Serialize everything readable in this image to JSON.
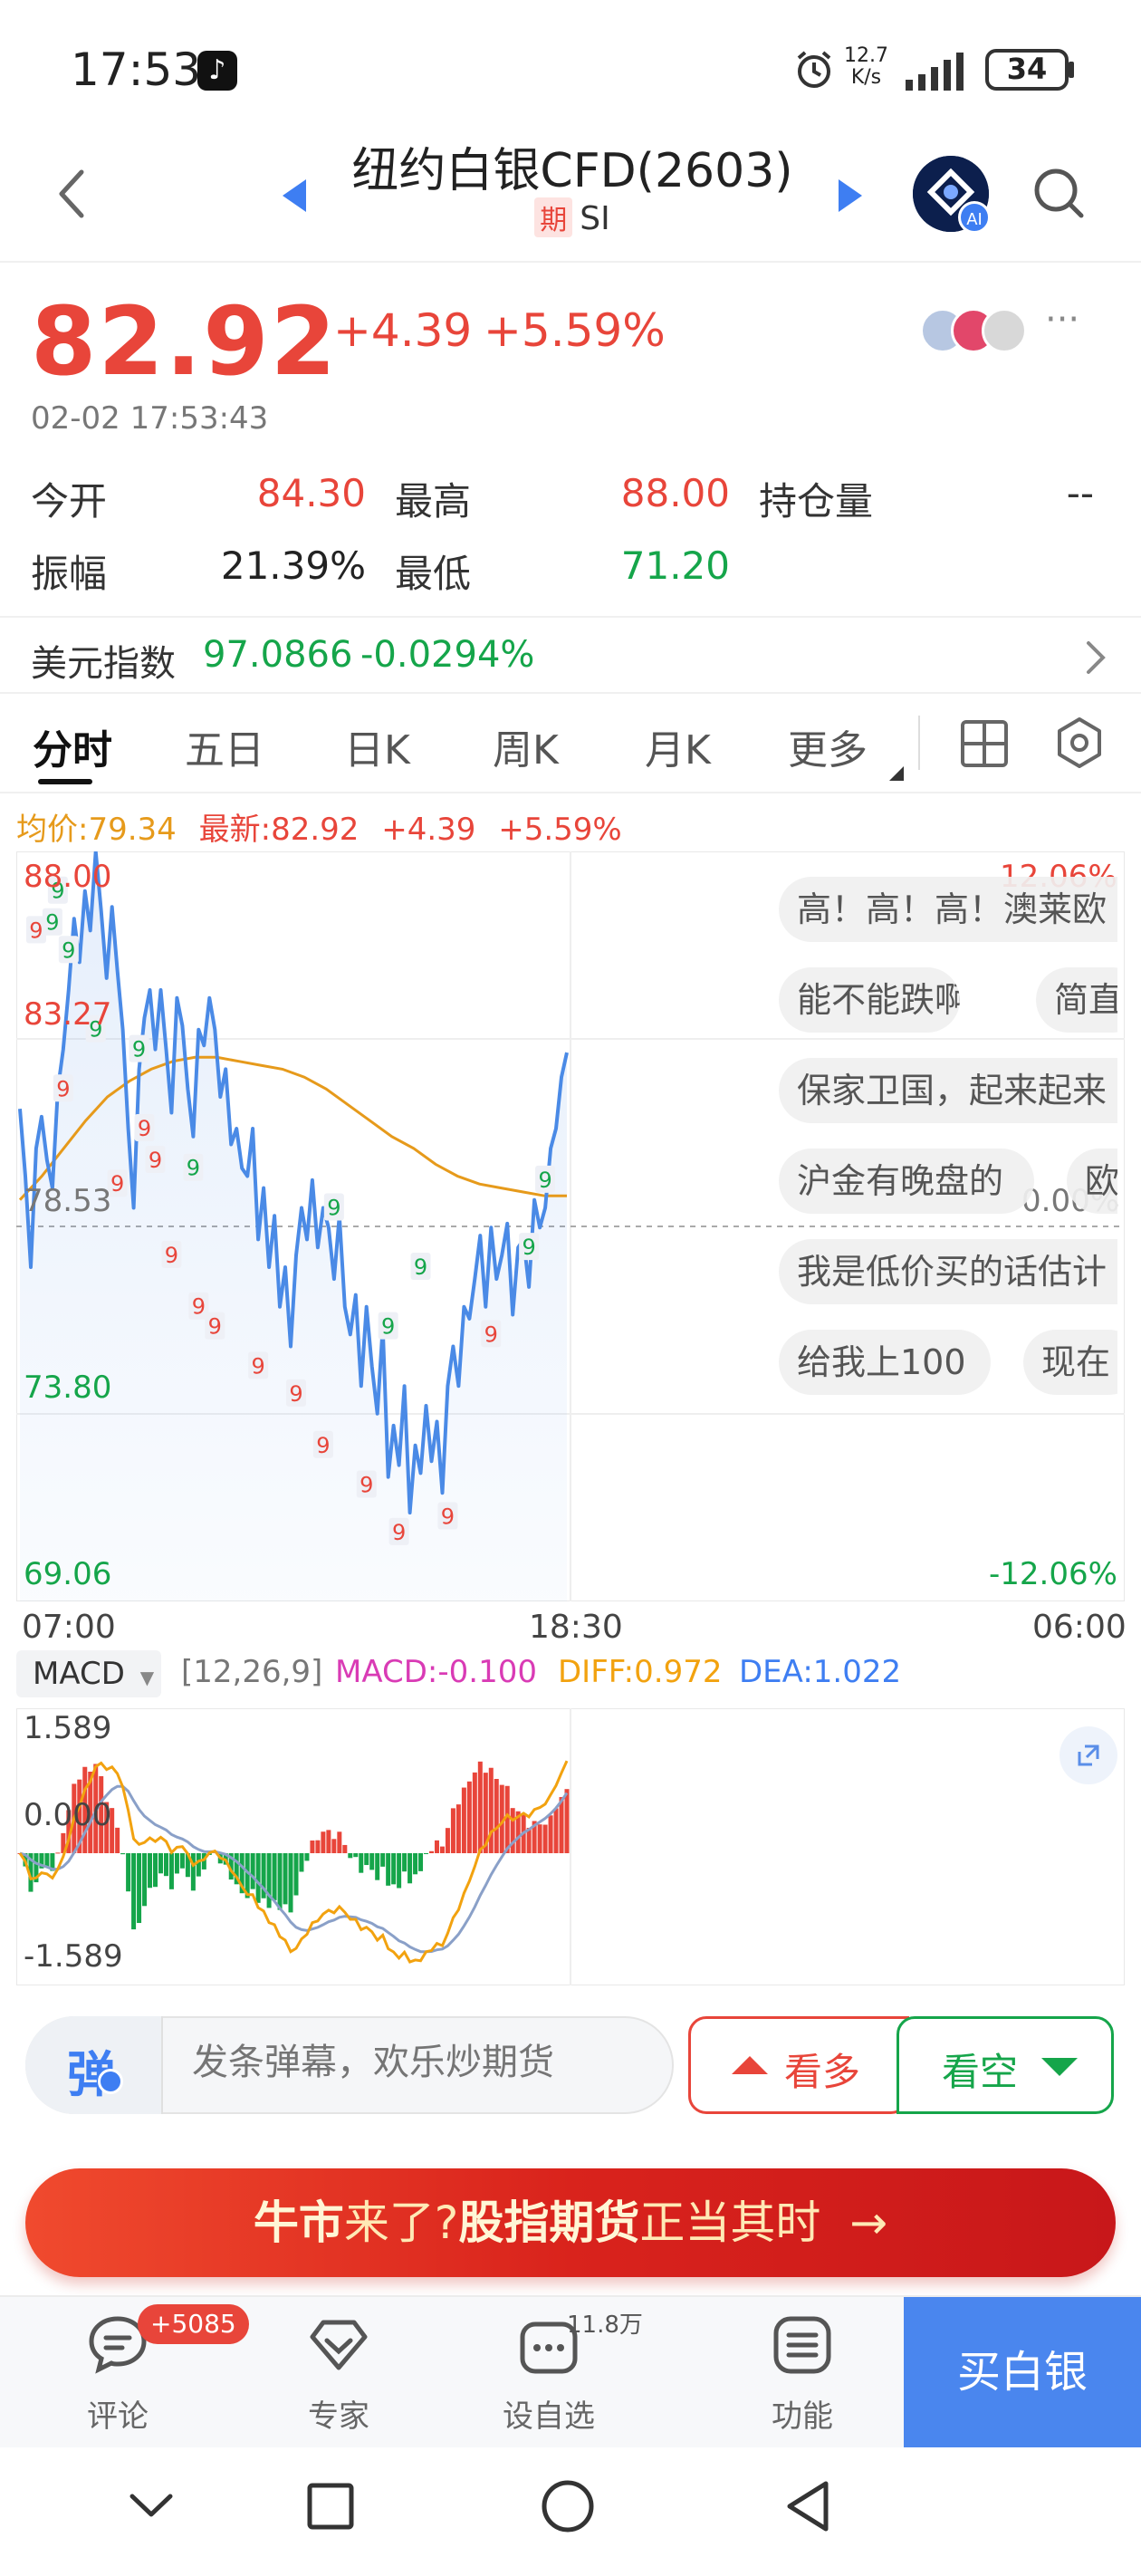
{
  "status_bar": {
    "time": "17:53",
    "net_speed_value": "12.7",
    "net_speed_unit": "K/s",
    "battery": "34"
  },
  "header": {
    "title": "纽约白银CFD(2603)",
    "futures_badge": "期",
    "symbol": "SI",
    "ai_badge": "AI"
  },
  "quote": {
    "last_price": "82.92",
    "change": "+4.39",
    "change_pct": "+5.59%",
    "time": "02-02 17:53:43",
    "more": "···"
  },
  "stats": {
    "open_label": "今开",
    "open_value": "84.30",
    "high_label": "最高",
    "high_value": "88.00",
    "oi_label": "持仓量",
    "oi_value": "--",
    "amp_label": "振幅",
    "amp_value": "21.39%",
    "low_label": "最低",
    "low_value": "71.20"
  },
  "usd_index": {
    "label": "美元指数",
    "value": "97.0866",
    "change": "-0.0294%"
  },
  "tabs": [
    "分时",
    "五日",
    "日K",
    "周K",
    "月K",
    "更多"
  ],
  "indicator": {
    "avg_label": "均价:79.34",
    "latest_label": "最新:82.92",
    "change": "+4.39",
    "change_pct": "+5.59%"
  },
  "chart_data": {
    "type": "line",
    "title": "",
    "y_ticks": [
      "88.00",
      "83.27",
      "78.53",
      "73.80",
      "69.06"
    ],
    "pct_ticks": [
      "12.06%",
      "0.00%",
      "-12.06%"
    ],
    "ylim": [
      69.06,
      88.0
    ],
    "prev_close": 78.53,
    "x_ticks": [
      "07:00",
      "18:30",
      "06:00"
    ],
    "series": [
      {
        "values": [
          81.5,
          79.8,
          77.5,
          80.5,
          81.3,
          80.2,
          79.5,
          82.0,
          83.0,
          84.5,
          86.3,
          85.2,
          87.0,
          86.0,
          88.0,
          86.5,
          84.8,
          86.6,
          85.0,
          83.5,
          81.0,
          79.0,
          82.5,
          83.8,
          84.5,
          83.0,
          84.5,
          83.0,
          81.4,
          84.3,
          83.6,
          82.0,
          80.8,
          83.5,
          83.1,
          84.3,
          83.5,
          81.8,
          82.5,
          80.6,
          81.0,
          80.0,
          79.8,
          81.0,
          78.2,
          79.5,
          77.5,
          78.8,
          76.5,
          77.5,
          75.5,
          77.8,
          79.0,
          78.2,
          79.7,
          78.0,
          79.0,
          78.5,
          77.2,
          78.8,
          76.5,
          75.8,
          76.8,
          74.5,
          76.5,
          75.0,
          73.8,
          76.0,
          72.2,
          73.5,
          72.5,
          74.5,
          71.3,
          73.0,
          72.3,
          74.0,
          72.6,
          73.6,
          71.8,
          74.5,
          75.5,
          74.5,
          76.5,
          76.2,
          77.2,
          78.3,
          76.5,
          78.5,
          77.2,
          77.8,
          78.6,
          76.3,
          78.0,
          78.2,
          77.0,
          79.2,
          78.5,
          79.0,
          80.5,
          81.0,
          82.3,
          82.92
        ]
      },
      {
        "name": "均价",
        "values": [
          79.2,
          79.8,
          80.5,
          81.2,
          81.8,
          82.2,
          82.5,
          82.7,
          82.8,
          82.8,
          82.7,
          82.6,
          82.5,
          82.3,
          82.0,
          81.6,
          81.2,
          80.8,
          80.5,
          80.1,
          79.8,
          79.6,
          79.5,
          79.4,
          79.3,
          79.3
        ]
      }
    ],
    "nine_markers_green": [
      [
        6,
        86.2
      ],
      [
        7,
        87.0
      ],
      [
        9,
        85.5
      ],
      [
        14,
        83.5
      ],
      [
        22,
        83.0
      ],
      [
        32,
        80.0
      ],
      [
        58,
        79.0
      ],
      [
        68,
        76.0
      ],
      [
        74,
        77.5
      ],
      [
        94,
        78.0
      ],
      [
        97,
        79.7
      ]
    ],
    "nine_markers_red": [
      [
        3,
        86.0
      ],
      [
        8,
        82.0
      ],
      [
        18,
        79.6
      ],
      [
        23,
        81.0
      ],
      [
        25,
        80.2
      ],
      [
        28,
        77.8
      ],
      [
        33,
        76.5
      ],
      [
        36,
        76.0
      ],
      [
        44,
        75.0
      ],
      [
        51,
        74.3
      ],
      [
        56,
        73.0
      ],
      [
        64,
        72.0
      ],
      [
        70,
        70.8
      ],
      [
        79,
        71.2
      ],
      [
        87,
        75.8
      ]
    ]
  },
  "danmaku": [
    "高！高！高！澳莱欧",
    "能不能跌啊",
    "简直",
    "保家卫国，起来起来",
    "沪金有晚盘的",
    "欧",
    "我是低价买的话估计",
    "给我上100",
    "现在"
  ],
  "macd": {
    "selector": "MACD",
    "params": "[12,26,9]",
    "macd": "MACD:-0.100",
    "diff": "DIFF:0.972",
    "dea": "DEA:1.022",
    "ticks": [
      "1.589",
      "0.000",
      "-1.589"
    ],
    "colors": {
      "pos": "#e8453a",
      "neg": "#15a54a",
      "diff": "#f2a20f",
      "dea": "#8aa0c8"
    }
  },
  "comment_bar": {
    "toggle": "弹",
    "placeholder": "发条弹幕，欢乐炒期货",
    "bull": "看多",
    "bear": "看空"
  },
  "promo": {
    "part1": "牛市",
    "part2": "来了?",
    "part3": "股指期货",
    "part4": "正当其时",
    "arrow": "→"
  },
  "bottom_nav": {
    "comment": "评论",
    "comment_badge": "+5085",
    "expert": "专家",
    "picks": "设自选",
    "picks_count": "11.8万",
    "functions": "功能",
    "buy": "买白银"
  },
  "colors": {
    "up": "#e8453a",
    "down": "#15a54a",
    "accent": "#4a86ee",
    "line": "#4a8ae6",
    "avg": "#e69a1b"
  }
}
